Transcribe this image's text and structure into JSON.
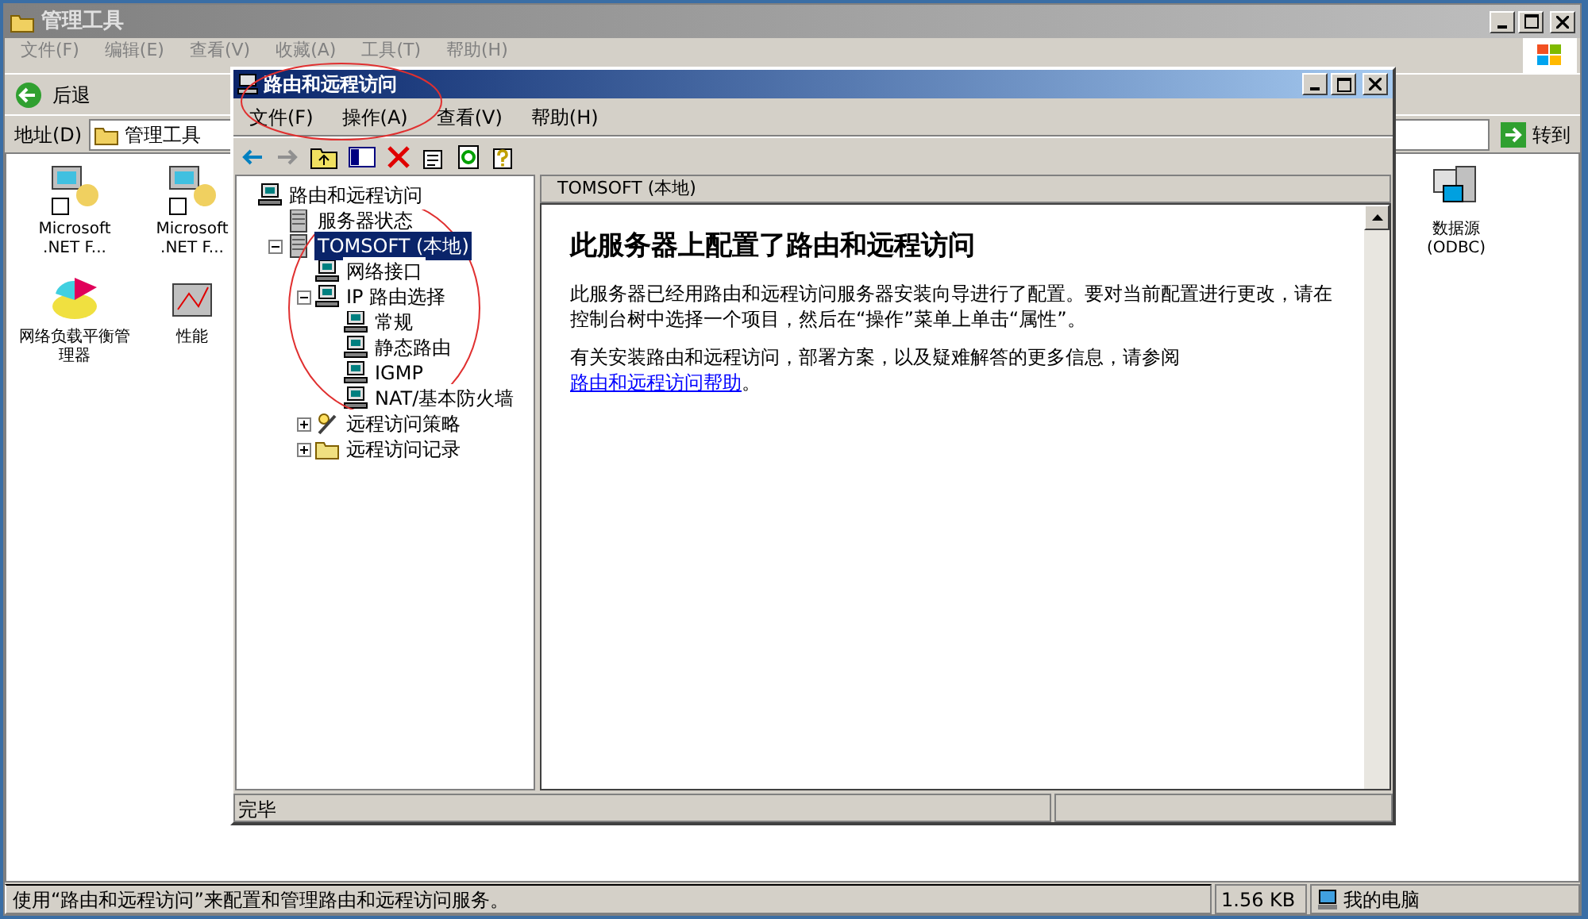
{
  "outer_window": {
    "title": "管理工具",
    "menu": [
      "文件(F)",
      "编辑(E)",
      "查看(V)",
      "收藏(A)",
      "工具(T)",
      "帮助(H)"
    ],
    "toolbar": {
      "back": "后退"
    },
    "address": {
      "label": "地址(D)",
      "value": "管理工具",
      "go": "转到"
    },
    "icons_left": [
      {
        "label": "Microsoft .NET F...",
        "kind": "admin"
      },
      {
        "label": "Microsoft .NET F...",
        "kind": "admin"
      },
      {
        "label": "网络负载平衡管理器",
        "kind": "chart"
      },
      {
        "label": "性能",
        "kind": "perf"
      }
    ],
    "icons_right": [
      {
        "label": "数据源 (ODBC)",
        "kind": "db"
      }
    ],
    "status_bar": {
      "text": "使用“路由和远程访问”来配置和管理路由和远程访问服务。",
      "size": "1.56 KB",
      "zone": "我的电脑"
    }
  },
  "mmc_window": {
    "title": "路由和远程访问",
    "menu": [
      "文件(F)",
      "操作(A)",
      "查看(V)",
      "帮助(H)"
    ],
    "tree": [
      {
        "label": "路由和远程访问",
        "kind": "computer",
        "selected": false,
        "children": [
          {
            "label": "服务器状态",
            "kind": "server",
            "selected": false
          },
          {
            "label": "TOMSOFT (本地)",
            "kind": "server",
            "selected": true,
            "expanded": true,
            "children": [
              {
                "label": "网络接口",
                "kind": "computer",
                "selected": false
              },
              {
                "label": "IP 路由选择",
                "kind": "computer",
                "selected": false,
                "expanded": true,
                "children": [
                  {
                    "label": "常规",
                    "kind": "computer",
                    "selected": false
                  },
                  {
                    "label": "静态路由",
                    "kind": "computer",
                    "selected": false
                  },
                  {
                    "label": "IGMP",
                    "kind": "computer",
                    "selected": false
                  },
                  {
                    "label": "NAT/基本防火墙",
                    "kind": "computer",
                    "selected": false
                  }
                ]
              },
              {
                "label": "远程访问策略",
                "kind": "policy",
                "selected": false,
                "expanded": false
              },
              {
                "label": "远程访问记录",
                "kind": "folder",
                "selected": false,
                "expanded": false
              }
            ]
          }
        ]
      }
    ],
    "detail": {
      "header": "TOMSOFT (本地)",
      "heading": "此服务器上配置了路由和远程访问",
      "paragraph_1": "此服务器已经用路由和远程访问服务器安装向导进行了配置。要对当前配置进行更改，请在控制台树中选择一个项目，然后在“操作”菜单上单击“属性”。",
      "paragraph_2": "有关安装路由和远程访问，部署方案，以及疑难解答的更多信息，请参阅",
      "link": "路由和远程访问帮助",
      "paragraph_2_end": "。"
    },
    "status_bar": {
      "text": "完毕"
    }
  }
}
